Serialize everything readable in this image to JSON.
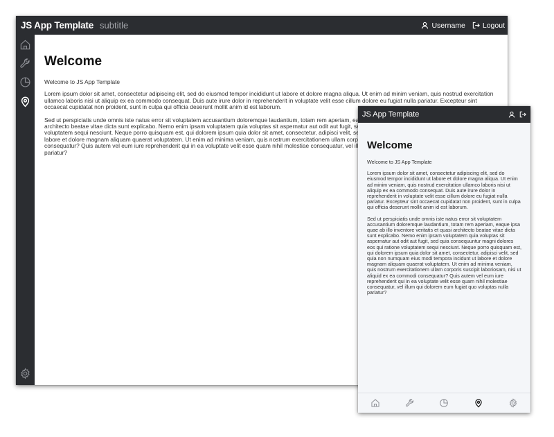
{
  "app": {
    "title": "JS App Template",
    "subtitle": "subtitle"
  },
  "header": {
    "username": "Username",
    "logout": "Logout"
  },
  "nav": {
    "items": [
      {
        "name": "home",
        "icon": "home-icon"
      },
      {
        "name": "tools",
        "icon": "wrench-icon"
      },
      {
        "name": "charts",
        "icon": "pie-chart-icon"
      },
      {
        "name": "location",
        "icon": "map-pin-icon",
        "active": true
      },
      {
        "name": "settings",
        "icon": "gear-icon"
      }
    ]
  },
  "content": {
    "heading": "Welcome",
    "intro": "Welcome to JS App Template",
    "paragraph1": "Lorem ipsum dolor sit amet, consectetur adipiscing elit, sed do eiusmod tempor incididunt ut labore et dolore magna aliqua. Ut enim ad minim veniam, quis nostrud exercitation ullamco laboris nisi ut aliquip ex ea commodo consequat. Duis aute irure dolor in reprehenderit in voluptate velit esse cillum dolore eu fugiat nulla pariatur. Excepteur sint occaecat cupidatat non proident, sunt in culpa qui officia deserunt mollit anim id est laborum.",
    "paragraph2": "Sed ut perspiciatis unde omnis iste natus error sit voluptatem accusantium doloremque laudantium, totam rem aperiam, eaque ipsa quae ab illo inventore veritatis et quasi architecto beatae vitae dicta sunt explicabo. Nemo enim ipsam voluptatem quia voluptas sit aspernatur aut odit aut fugit, sed quia consequuntur magni dolores eos qui ratione voluptatem sequi nesciunt. Neque porro quisquam est, qui dolorem ipsum quia dolor sit amet, consectetur, adipisci velit, sed quia non numquam eius modi tempora incidunt ut labore et dolore magnam aliquam quaerat voluptatem. Ut enim ad minima veniam, quis nostrum exercitationem ullam corporis suscipit laboriosam, nisi ut aliquid ex ea commodi consequatur? Quis autem vel eum iure reprehenderit qui in ea voluptate velit esse quam nihil molestiae consequatur, vel illum qui dolorem eum fugiat quo voluptas nulla pariatur?"
  },
  "colors": {
    "bar": "#2b2d31",
    "muted_icon": "#8e9096",
    "active_icon": "#ffffff",
    "mobile_bg": "#f4f6f9"
  }
}
